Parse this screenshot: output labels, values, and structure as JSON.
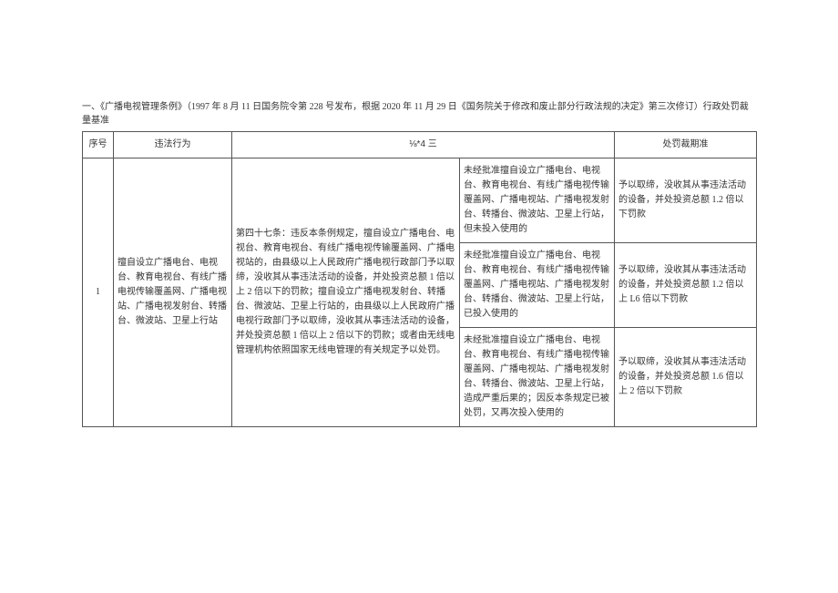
{
  "title": "一、《广播电视管理条例》（1997 年 8 月 11 日国务院令第 228 号发布，根据 2020 年 11 月 29 日《国务院关于修改和废止部分行政法规的决定》第三次修订）行政处罚裁量基准",
  "headers": {
    "seq": "序号",
    "act": "违法行为",
    "basis": "⅛*4 三",
    "standard": "处罚裁期准"
  },
  "row1": {
    "seq": "1",
    "act": "擅自设立广播电台、电视台、教育电视台、有线广播电视传输覆盖网、广播电视站、广播电视发射台、转播台、微波站、卫星上行站",
    "basis": "第四十七条：违反本条例规定，擅自设立广播电台、电视台、教育电视台、有线广播电视传输覆盖网、广播电视站的，由县级以上人民政府广播电视行政部门予以取缔，没收其从事违法活动的设备，并处投资总额 1 倍以上 2 倍以下的罚款；擅自设立广播电视发射台、转播台、微波站、卫星上行站的，由县级以上人民政府广播电视行政部门予以取缔，没收其从事违法活动的设备，并处投资总额 1 倍以上 2 倍以下的罚款；或者由无线电管理机构依照国家无线电管理的有关规定予以处罚。",
    "situations": [
      "未经批准擅自设立广播电台、电视台、教育电视台、有线广播电视传输覆盖网、广播电视站、广播电视发射台、转播台、微波站、卫星上行站，但未投入使用的",
      "未经批准擅自设立广播电台、电视台、教育电视台、有线广播电视传输覆盖网、广播电视站、广播电视发射台、转播台、微波站、卫星上行站，已投入使用的",
      "未经批准擅自设立广播电台、电视台、教育电视台、有线广播电视传输覆盖网、广播电视站、广播电视发射台、转播台、微波站、卫星上行站，造成严重后果的；因反本条规定已被处罚，又再次投入使用的"
    ],
    "standards": [
      "予以取缔，没收其从事违法活动的设备，并处投资总额 1.2 倍以下罚款",
      "予以取缔，没收其从事违法活动的设备，并处投资总额 1.2 倍以上 L6 倍以下罚款",
      "予以取缔，没收其从事违法活动的设备，并处投资总额 1.6 倍以上 2 倍以下罚款"
    ]
  }
}
